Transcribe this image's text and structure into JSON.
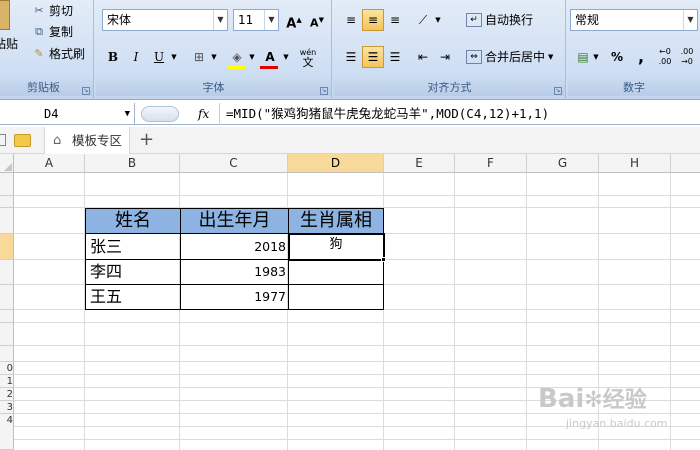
{
  "ribbon": {
    "clipboard": {
      "paste_label": "粘贴",
      "cut_label": "剪切",
      "copy_label": "复制",
      "format_painter_label": "格式刷",
      "group_label": "剪贴板"
    },
    "font": {
      "font_name": "宋体",
      "font_size": "11",
      "bold": "B",
      "italic": "I",
      "underline": "U",
      "font_color_glyph": "A",
      "wen_glyph": "wén",
      "group_label": "字体"
    },
    "alignment": {
      "wrap_text_label": "自动换行",
      "merge_center_label": "合并后居中",
      "group_label": "对齐方式"
    },
    "number": {
      "format_value": "常规",
      "percent": "%",
      "comma": ",",
      "group_label": "数字"
    }
  },
  "formula_bar": {
    "name_box": "D4",
    "fx": "fx",
    "formula": "=MID(\"猴鸡狗猪鼠牛虎兔龙蛇马羊\",MOD(C4,12)+1,1)"
  },
  "tabs": {
    "template_label": "模板专区",
    "add_label": "+"
  },
  "grid": {
    "columns": [
      "A",
      "B",
      "C",
      "D",
      "E",
      "F",
      "G",
      "H"
    ],
    "row_labels": [
      "",
      "",
      "",
      "",
      "",
      "",
      "",
      "",
      "",
      "0",
      "1",
      "2",
      "3",
      "4"
    ],
    "table": {
      "headers": [
        "姓名",
        "出生年月",
        "生肖属相"
      ],
      "rows": [
        {
          "name": "张三",
          "year": "2018",
          "zodiac": "狗"
        },
        {
          "name": "李四",
          "year": "1983",
          "zodiac": ""
        },
        {
          "name": "王五",
          "year": "1977",
          "zodiac": ""
        }
      ]
    }
  },
  "watermark": {
    "brand": "Bai",
    "brand2": "经验",
    "url": "jingyan.baidu.com"
  }
}
